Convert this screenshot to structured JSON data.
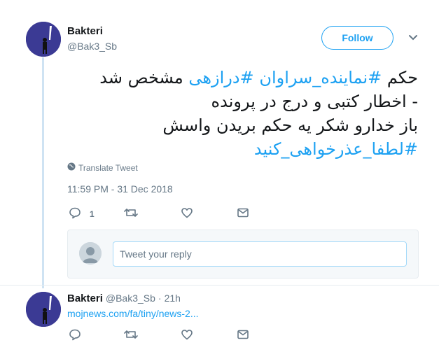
{
  "author": {
    "name": "Bakteri",
    "handle": "@Bak3_Sb",
    "follow_label": "Follow"
  },
  "tweet": {
    "lines": [
      [
        "حکم ",
        "#نماینده_سراوان",
        " ",
        "#درازهی",
        " مشخص شد"
      ],
      [
        "- اخطار کتبی و درج در پرونده"
      ],
      [
        "باز خدارو شکر یه حکم بریدن واسش"
      ],
      [
        "#لطفا_عذرخواهی_کنید"
      ]
    ],
    "translate_label": "Translate Tweet",
    "timestamp": "11:59 PM - 31 Dec 2018",
    "reply_count": "1"
  },
  "reply_box": {
    "placeholder": "Tweet your reply"
  },
  "reply": {
    "name": "Bakteri",
    "handle": "@Bak3_Sb",
    "time": "21h",
    "link": "mojnews.com/fa/tiny/news-2..."
  },
  "colors": {
    "accent": "#1da1f2",
    "avatar_bg": "#3b3a94",
    "muted": "#657786"
  },
  "icons": [
    "reply-icon",
    "retweet-icon",
    "like-icon",
    "dm-icon",
    "globe-icon",
    "chevron-down-icon"
  ]
}
